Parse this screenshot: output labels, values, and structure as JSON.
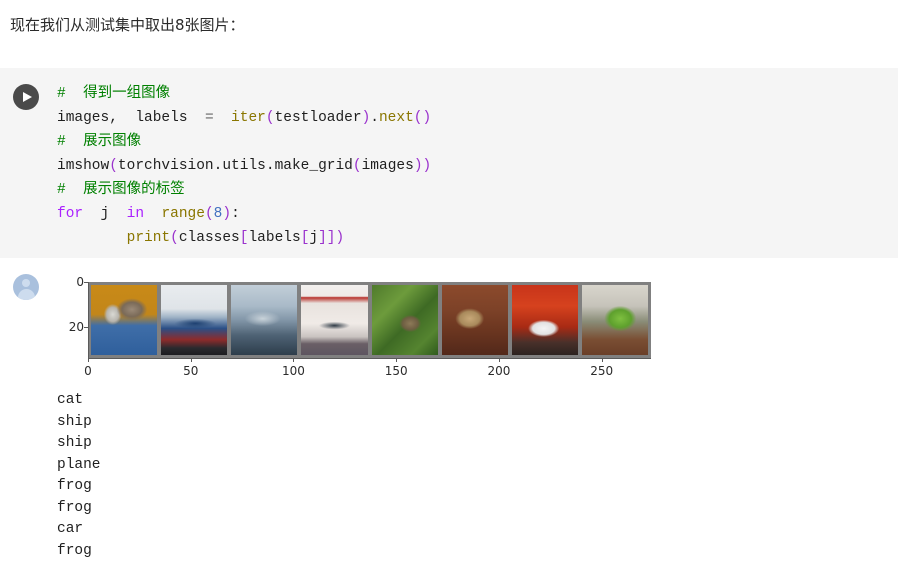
{
  "intro": {
    "text": "现在我们从测试集中取出8张图片："
  },
  "code_cell": {
    "run_icon": "play-icon",
    "lines": [
      {
        "id": "line-1",
        "tokens": [
          {
            "t": "#  得到一组图像",
            "c": "comment"
          }
        ]
      },
      {
        "id": "line-2",
        "tokens": [
          {
            "t": "images,  labels  ",
            "c": "plain"
          },
          {
            "t": "=",
            "c": "op"
          },
          {
            "t": "  ",
            "c": "plain"
          },
          {
            "t": "iter",
            "c": "builtin"
          },
          {
            "t": "(",
            "c": "punct"
          },
          {
            "t": "testloader",
            "c": "plain"
          },
          {
            "t": ")",
            "c": "punct"
          },
          {
            "t": ".",
            "c": "plain"
          },
          {
            "t": "next",
            "c": "builtin"
          },
          {
            "t": "()",
            "c": "punct"
          }
        ]
      },
      {
        "id": "line-3",
        "tokens": [
          {
            "t": "#  展示图像",
            "c": "comment"
          }
        ]
      },
      {
        "id": "line-4",
        "tokens": [
          {
            "t": "imshow",
            "c": "plain"
          },
          {
            "t": "(",
            "c": "punct"
          },
          {
            "t": "torchvision",
            "c": "plain"
          },
          {
            "t": ".",
            "c": "plain"
          },
          {
            "t": "utils",
            "c": "plain"
          },
          {
            "t": ".",
            "c": "plain"
          },
          {
            "t": "make_grid",
            "c": "plain"
          },
          {
            "t": "(",
            "c": "punct"
          },
          {
            "t": "images",
            "c": "plain"
          },
          {
            "t": "))",
            "c": "punct"
          }
        ]
      },
      {
        "id": "line-5",
        "tokens": [
          {
            "t": "#  展示图像的标签",
            "c": "comment"
          }
        ]
      },
      {
        "id": "line-6",
        "tokens": [
          {
            "t": "for",
            "c": "keyword"
          },
          {
            "t": "  j  ",
            "c": "plain"
          },
          {
            "t": "in",
            "c": "keyword"
          },
          {
            "t": "  ",
            "c": "plain"
          },
          {
            "t": "range",
            "c": "builtin"
          },
          {
            "t": "(",
            "c": "punct"
          },
          {
            "t": "8",
            "c": "number"
          },
          {
            "t": ")",
            "c": "punct"
          },
          {
            "t": ":",
            "c": "plain"
          }
        ]
      },
      {
        "id": "line-7",
        "tokens": [
          {
            "t": "        ",
            "c": "plain"
          },
          {
            "t": "print",
            "c": "builtin"
          },
          {
            "t": "(",
            "c": "punct"
          },
          {
            "t": "classes",
            "c": "plain"
          },
          {
            "t": "[",
            "c": "punct"
          },
          {
            "t": "labels",
            "c": "plain"
          },
          {
            "t": "[",
            "c": "punct"
          },
          {
            "t": "j",
            "c": "plain"
          },
          {
            "t": "]])",
            "c": "punct"
          }
        ]
      }
    ]
  },
  "output_cell": {
    "avatar_icon": "user-avatar-icon",
    "stdout_lines": [
      "cat",
      "ship",
      "ship",
      "plane",
      "frog",
      "frog",
      "car",
      "frog"
    ]
  },
  "chart_data": {
    "type": "heatmap",
    "title": "",
    "xlabel": "",
    "ylabel": "",
    "xlim": [
      0,
      274
    ],
    "ylim": [
      34,
      0
    ],
    "grid": false,
    "legend": "none",
    "xticks": [
      0,
      50,
      100,
      150,
      200,
      250
    ],
    "xtick_labels": [
      "0",
      "50",
      "100",
      "150",
      "200",
      "250"
    ],
    "yticks": [
      0,
      20
    ],
    "ytick_labels": [
      "0",
      "20"
    ],
    "description": "torchvision make_grid of 8 CIFAR-10 test images on gray padding",
    "images": [
      {
        "index": 0,
        "label": "cat",
        "style_class": "img-cat",
        "dominant_colors": [
          "#c98a17",
          "#7a6a58",
          "#2f5f9c"
        ]
      },
      {
        "index": 1,
        "label": "ship",
        "style_class": "img-ship1",
        "dominant_colors": [
          "#e9ecef",
          "#2a4f86",
          "#8e2b2b"
        ]
      },
      {
        "index": 2,
        "label": "ship",
        "style_class": "img-ship2",
        "dominant_colors": [
          "#c2ced8",
          "#8296a8",
          "#2d3d4b"
        ]
      },
      {
        "index": 3,
        "label": "plane",
        "style_class": "img-plane",
        "dominant_colors": [
          "#f2f0ee",
          "#b8322c",
          "#5d5560"
        ]
      },
      {
        "index": 4,
        "label": "frog",
        "style_class": "img-frog1",
        "dominant_colors": [
          "#6d9b3c",
          "#6e5e42",
          "#2f5a1c"
        ]
      },
      {
        "index": 5,
        "label": "frog",
        "style_class": "img-frog2",
        "dominant_colors": [
          "#8c4a2c",
          "#a98a5c",
          "#52281a"
        ]
      },
      {
        "index": 6,
        "label": "car",
        "style_class": "img-car",
        "dominant_colors": [
          "#d6421e",
          "#f4f4f4",
          "#2c2320"
        ]
      },
      {
        "index": 7,
        "label": "frog",
        "style_class": "img-frog3",
        "dominant_colors": [
          "#5ea02d",
          "#c6c3ba",
          "#6a3f28"
        ]
      }
    ]
  },
  "colors": {
    "code_background": "#f5f5f5",
    "page_background": "#ffffff",
    "comment": "#008000",
    "keyword": "#aa22ff",
    "builtin": "#8a7600",
    "punctuation": "#9a32cd",
    "number": "#4070c0",
    "run_button": "#4a4a4a",
    "avatar": "#a9c0dd",
    "grid_padding": "#808080"
  }
}
